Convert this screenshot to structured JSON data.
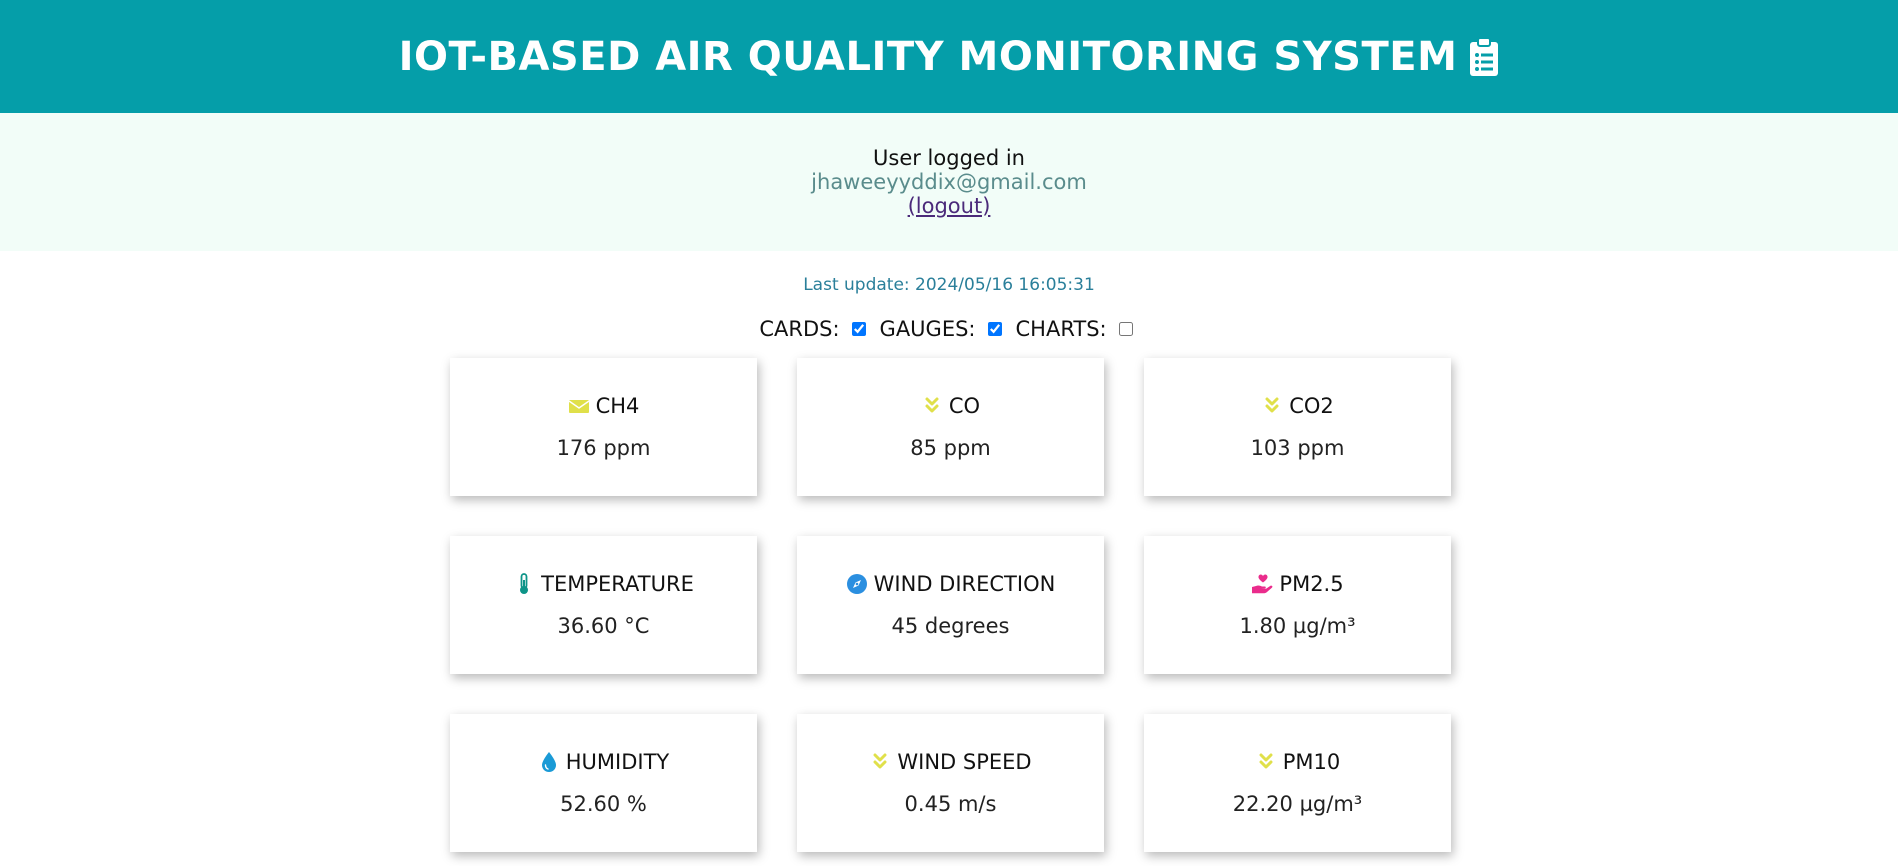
{
  "header": {
    "title": "IOT-BASED AIR QUALITY MONITORING SYSTEM",
    "icon": "clipboard-list-icon"
  },
  "auth": {
    "status": "User logged in",
    "email": "jhaweeyyddix@gmail.com",
    "logout": "(logout)"
  },
  "last_update": "Last update: 2024/05/16 16:05:31",
  "toggles": [
    {
      "label": "CARDS:",
      "checked": true
    },
    {
      "label": "GAUGES:",
      "checked": true
    },
    {
      "label": "CHARTS:",
      "checked": false
    }
  ],
  "cards": [
    {
      "title": "CH4",
      "value": "176 ppm",
      "icon": "envelope-icon",
      "color": "#e0e04a"
    },
    {
      "title": "CO",
      "value": "85 ppm",
      "icon": "double-chevron-down-icon",
      "color": "#e0e04a"
    },
    {
      "title": "CO2",
      "value": "103 ppm",
      "icon": "double-chevron-down-icon",
      "color": "#e0e04a"
    },
    {
      "title": "TEMPERATURE",
      "value": "36.60 °C",
      "icon": "thermometer-icon",
      "color": "#0d9488"
    },
    {
      "title": "WIND DIRECTION",
      "value": "45 degrees",
      "icon": "compass-icon",
      "color": "#2b8fe0"
    },
    {
      "title": "PM2.5",
      "value": "1.80 µg/m³",
      "icon": "hand-heart-icon",
      "color": "#ea2c8c"
    },
    {
      "title": "HUMIDITY",
      "value": "52.60 %",
      "icon": "droplet-icon",
      "color": "#1a9ad6"
    },
    {
      "title": "WIND SPEED",
      "value": "0.45 m/s",
      "icon": "double-chevron-down-icon",
      "color": "#e0e04a"
    },
    {
      "title": "PM10",
      "value": "22.20 µg/m³",
      "icon": "double-chevron-down-icon",
      "color": "#e0e04a"
    }
  ]
}
